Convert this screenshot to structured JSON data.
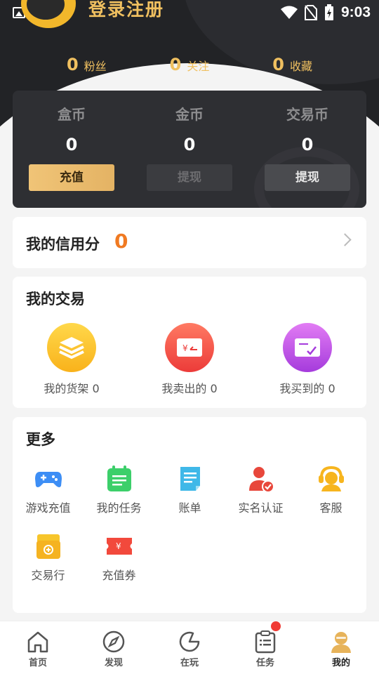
{
  "header": {
    "login_text": "登录注册",
    "status_time": "9:03"
  },
  "stats": [
    {
      "num": "0",
      "label": "粉丝"
    },
    {
      "num": "0",
      "label": "关注"
    },
    {
      "num": "0",
      "label": "收藏"
    }
  ],
  "wallet": [
    {
      "name": "盒币",
      "amount": "0",
      "button": "充值"
    },
    {
      "name": "金币",
      "amount": "0",
      "button": "提现"
    },
    {
      "name": "交易币",
      "amount": "0",
      "button": "提现"
    }
  ],
  "credit": {
    "title": "我的信用分",
    "score": "0"
  },
  "trade": {
    "title": "我的交易",
    "items": [
      {
        "label": "我的货架 0",
        "icon": "stack-icon"
      },
      {
        "label": "我卖出的 0",
        "icon": "sell-icon"
      },
      {
        "label": "我买到的 0",
        "icon": "bought-icon"
      }
    ]
  },
  "more": {
    "title": "更多",
    "items": [
      {
        "label": "游戏充值",
        "icon": "gamepad-icon"
      },
      {
        "label": "我的任务",
        "icon": "task-icon"
      },
      {
        "label": "账单",
        "icon": "bill-icon"
      },
      {
        "label": "实名认证",
        "icon": "verify-icon"
      },
      {
        "label": "客服",
        "icon": "service-icon"
      },
      {
        "label": "交易行",
        "icon": "market-icon"
      },
      {
        "label": "充值券",
        "icon": "coupon-icon"
      }
    ]
  },
  "tabs": [
    {
      "label": "首页",
      "icon": "home-icon"
    },
    {
      "label": "发现",
      "icon": "compass-icon"
    },
    {
      "label": "在玩",
      "icon": "play-icon"
    },
    {
      "label": "任务",
      "icon": "tasks-icon"
    },
    {
      "label": "我的",
      "icon": "user-icon"
    }
  ],
  "colors": {
    "accent_gold": "#f0c060",
    "credit_orange": "#f07a22",
    "header_dark": "#222326"
  }
}
